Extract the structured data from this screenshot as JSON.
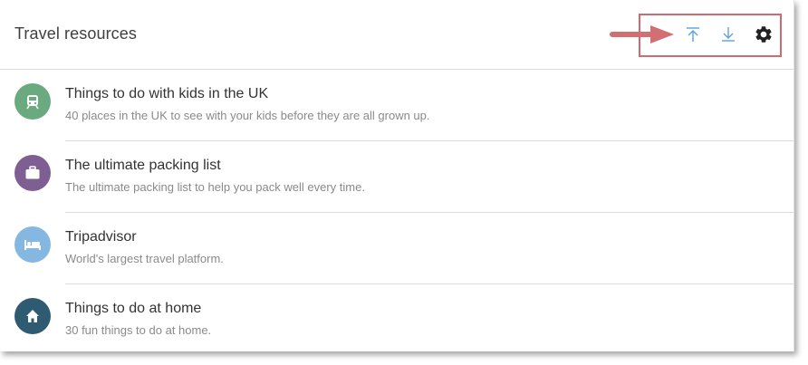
{
  "header": {
    "title": "Travel resources",
    "toolbar": {
      "upload_icon": "arrow-up-to-line-icon",
      "download_icon": "arrow-down-to-line-icon",
      "settings_icon": "gear-icon",
      "highlight_color": "#cf6b70",
      "icon_color": "#5aa3d8"
    }
  },
  "list": {
    "items": [
      {
        "title": "Things to do with kids in the UK",
        "subtitle": "40 places in the UK to see with your kids before they are all grown up.",
        "icon": "train-icon",
        "color": "#6aaa7e"
      },
      {
        "title": "The ultimate packing list",
        "subtitle": "The ultimate packing list to help you pack well every time.",
        "icon": "briefcase-icon",
        "color": "#7e5e93"
      },
      {
        "title": "Tripadvisor",
        "subtitle": "World's largest travel platform.",
        "icon": "bed-icon",
        "color": "#84b8e0"
      },
      {
        "title": "Things to do at home",
        "subtitle": "30 fun things to do at home.",
        "icon": "home-icon",
        "color": "#2f5b72"
      }
    ]
  }
}
